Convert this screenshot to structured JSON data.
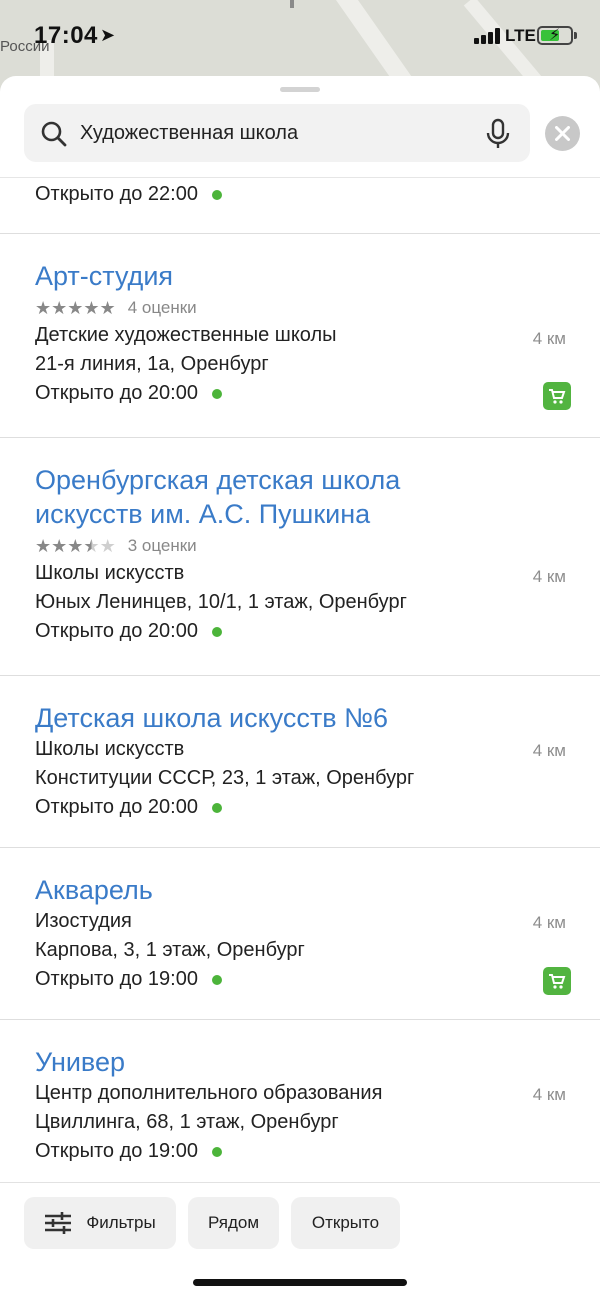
{
  "map": {
    "label": "России"
  },
  "status_bar": {
    "time": "17:04",
    "network": "LTE"
  },
  "search": {
    "query": "Художественная школа"
  },
  "results": [
    {
      "open": "Открыто до 22:00"
    },
    {
      "name": "Арт-студия",
      "stars": 5,
      "rating_count": "4 оценки",
      "category": "Детские художественные школы",
      "address": "21-я линия, 1а, Оренбург",
      "open": "Открыто до 20:00",
      "distance": "4 км",
      "cart": true
    },
    {
      "name_line1": "Оренбургская детская школа",
      "name_line2": "искусств им. А.С. Пушкина",
      "stars": 3.5,
      "rating_count": "3 оценки",
      "category": "Школы искусств",
      "address": "Юных Ленинцев, 10/1, 1 этаж, Оренбург",
      "open": "Открыто до 20:00",
      "distance": "4 км"
    },
    {
      "name": "Детская школа искусств №6",
      "category": "Школы искусств",
      "address": "Конституции СССР, 23, 1 этаж, Оренбург",
      "open": "Открыто до 20:00",
      "distance": "4 км"
    },
    {
      "name": "Акварель",
      "category": "Изостудия",
      "address": "Карпова, 3, 1 этаж, Оренбург",
      "open": "Открыто до 19:00",
      "distance": "4 км",
      "cart": true
    },
    {
      "name": "Универ",
      "category": "Центр дополнительного образования",
      "address": "Цвиллинга, 68, 1 этаж, Оренбург",
      "open": "Открыто до 19:00",
      "distance": "4 км"
    }
  ],
  "toolbar": {
    "filters": "Фильтры",
    "nearby": "Рядом",
    "open_now": "Открыто"
  },
  "colors": {
    "link": "#3a7bc8",
    "open_dot": "#4cb43a",
    "cart_badge": "#52b440"
  },
  "icons": [
    "location-arrow-icon",
    "search-icon",
    "microphone-icon",
    "close-icon",
    "cart-icon",
    "filters-icon"
  ]
}
